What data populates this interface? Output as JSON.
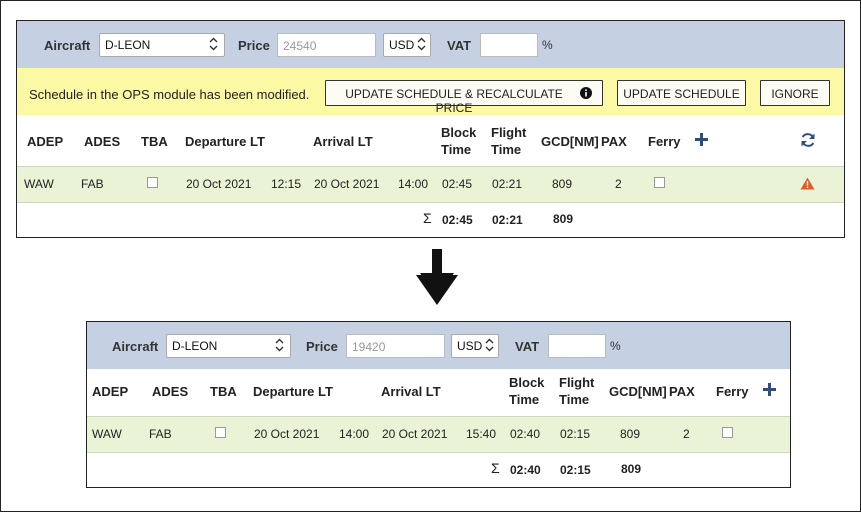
{
  "columns": {
    "adep": "ADEP",
    "ades": "ADES",
    "tba": "TBA",
    "departure": "Departure LT",
    "arrival": "Arrival LT",
    "block_1": "Block",
    "block_2": "Time",
    "flight_1": "Flight",
    "flight_2": "Time",
    "gcd": "GCD[NM]",
    "pax": "PAX",
    "ferry": "Ferry"
  },
  "labels": {
    "aircraft": "Aircraft",
    "price": "Price",
    "vat": "VAT",
    "percent": "%",
    "sigma": "Σ"
  },
  "before": {
    "aircraft": "D-LEON",
    "price": "24540",
    "currency": "USD",
    "vat": "",
    "notice": {
      "message": "Schedule in the OPS module has been modified.",
      "update_recalc_label": "UPDATE SCHEDULE & RECALCULATE PRICE",
      "update_label": "UPDATE SCHEDULE",
      "ignore_label": "IGNORE"
    },
    "row": {
      "adep": "WAW",
      "ades": "FAB",
      "dep_date": "20 Oct 2021",
      "dep_time": "12:15",
      "arr_date": "20 Oct 2021",
      "arr_time": "14:00",
      "block": "02:45",
      "flight": "02:21",
      "gcd": "809",
      "pax": "2"
    },
    "totals": {
      "block": "02:45",
      "flight": "02:21",
      "gcd": "809"
    }
  },
  "after": {
    "aircraft": "D-LEON",
    "price": "19420",
    "currency": "USD",
    "vat": "",
    "row": {
      "adep": "WAW",
      "ades": "FAB",
      "dep_date": "20 Oct 2021",
      "dep_time": "14:00",
      "arr_date": "20 Oct 2021",
      "arr_time": "15:40",
      "block": "02:40",
      "flight": "02:15",
      "gcd": "809",
      "pax": "2"
    },
    "totals": {
      "block": "02:40",
      "flight": "02:15",
      "gcd": "809"
    }
  },
  "colors": {
    "header_bg": "#c5d1e3",
    "notice_bg": "#fbf9a3",
    "row_bg": "#eaf3d6",
    "accent_blue": "#2f4f7a",
    "warning": "#e05a2b"
  }
}
